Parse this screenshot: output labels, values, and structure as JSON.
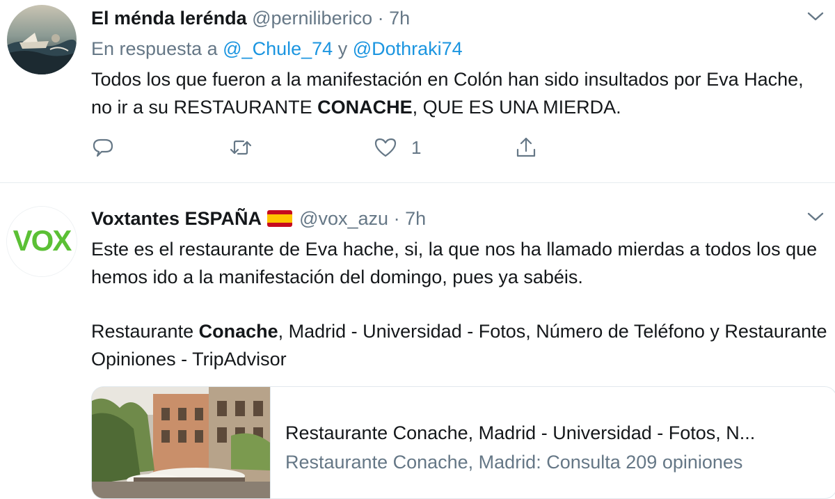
{
  "tweet1": {
    "name": "El ménda lerénda",
    "handle": "@perniliberico",
    "dot": "·",
    "time": "7h",
    "reply_prefix": "En respuesta a",
    "mention1": "@_Chule_74",
    "reply_and": "y",
    "mention2": "@Dothraki74",
    "text_part1": "Todos los que fueron a la manifestación en Colón han sido insultados por Eva Hache, no ir a su RESTAURANTE ",
    "text_bold": "CONACHE",
    "text_part2": ", QUE ES UNA MIERDA.",
    "like_count": "1"
  },
  "tweet2": {
    "name": "Voxtantes ESPAÑA",
    "flag_icon": "spain-flag-icon",
    "handle": "@vox_azu",
    "dot": "·",
    "time": "7h",
    "avatar_logo": "VOX",
    "text_line": "Este es el restaurante de Eva hache, si, la que nos ha llamado mierdas a todos los que hemos ido a la manifestación del domingo, pues ya sabéis.",
    "link_part1": "Restaurante ",
    "link_bold": "Conache",
    "link_part2": ", Madrid - Universidad - Fotos, Número de Teléfono y Restaurante Opiniones - TripAdvisor",
    "card": {
      "title": "Restaurante Conache, Madrid - Universidad - Fotos, N...",
      "description": "Restaurante Conache, Madrid: Consulta 209 opiniones"
    }
  },
  "icons": [
    "reply-icon",
    "retweet-icon",
    "like-icon",
    "share-icon",
    "chevron-down-icon"
  ],
  "colors": {
    "text": "#14171a",
    "secondary": "#657786",
    "link": "#1b95e0",
    "vox_green": "#5bc035",
    "border": "#e1e8ed"
  }
}
